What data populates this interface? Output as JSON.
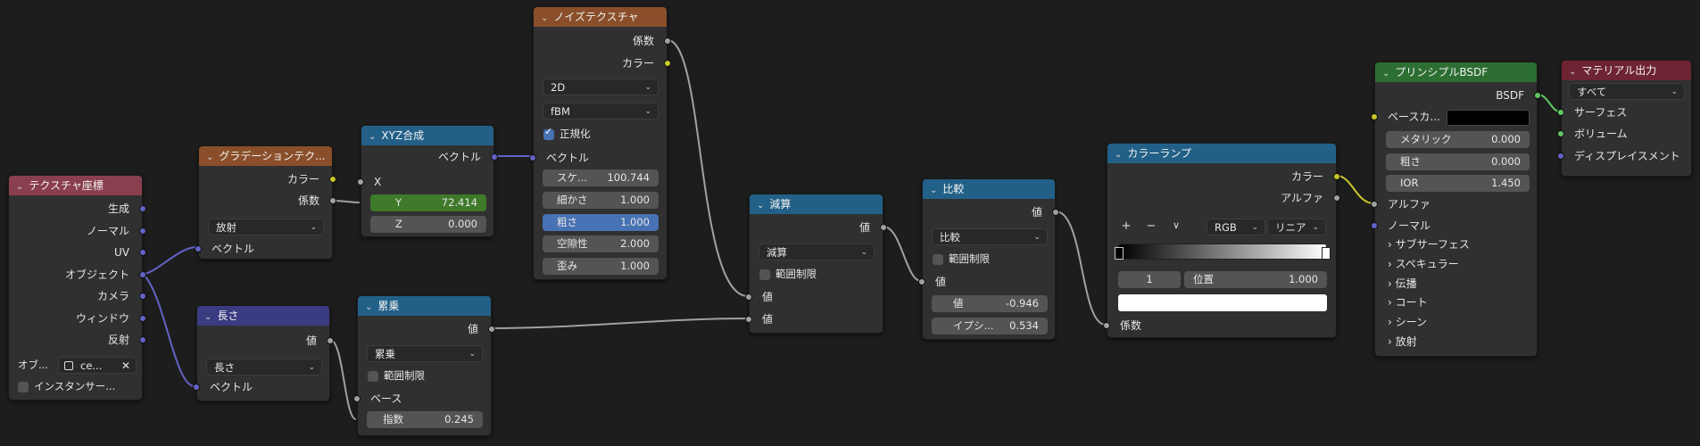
{
  "colors": {
    "tex": "#8a3f4f",
    "grad": "#8a4f2a",
    "vec": "#3b3b82",
    "conv": "#226087",
    "shader": "#2d6e33",
    "out": "#6e2433"
  },
  "nodes": {
    "texcoord": {
      "title": "テクスチャ座標",
      "outputs": [
        "生成",
        "ノーマル",
        "UV",
        "オブジェクト",
        "カメラ",
        "ウィンドウ",
        "反射"
      ],
      "object_label": "オブ...",
      "object_value": "ce...",
      "instancer_label": "インスタンサー..."
    },
    "gradient": {
      "title": "グラデーションテク...",
      "out_color": "カラー",
      "out_fac": "係数",
      "type": "放射",
      "in_vector": "ベクトル"
    },
    "length": {
      "title": "長さ",
      "out_value": "値",
      "op": "長さ",
      "in_vector": "ベクトル"
    },
    "xyz": {
      "title": "XYZ合成",
      "out_vector": "ベクトル",
      "x_label": "X",
      "y_label": "Y",
      "y_value": "72.414",
      "z_label": "Z",
      "z_value": "0.000"
    },
    "power": {
      "title": "累乗",
      "out_value": "値",
      "op": "累乗",
      "clamp": "範囲制限",
      "base": "ベース",
      "exp_label": "指数",
      "exp_value": "0.245"
    },
    "noise": {
      "title": "ノイズテクスチャ",
      "out_fac": "係数",
      "out_color": "カラー",
      "dim": "2D",
      "type": "fBM",
      "normalize": "正規化",
      "in_vector": "ベクトル",
      "scale_label": "スケ...",
      "scale_value": "100.744",
      "detail_label": "細かさ",
      "detail_value": "1.000",
      "rough_label": "粗さ",
      "rough_value": "1.000",
      "lac_label": "空隙性",
      "lac_value": "2.000",
      "dist_label": "歪み",
      "dist_value": "1.000"
    },
    "subtract": {
      "title": "減算",
      "out_value": "値",
      "op": "減算",
      "clamp": "範囲制限",
      "in1": "値",
      "in2": "値"
    },
    "compare": {
      "title": "比較",
      "out_value": "値",
      "op": "比較",
      "clamp": "範囲制限",
      "in1": "値",
      "val_label": "値",
      "val_value": "-0.946",
      "eps_label": "イプシ...",
      "eps_value": "0.534"
    },
    "ramp": {
      "title": "カラーランプ",
      "out_color": "カラー",
      "out_alpha": "アルファ",
      "plus": "+",
      "minus": "−",
      "menu": "∨",
      "mode": "RGB",
      "interp": "リニア",
      "index": "1",
      "pos_label": "位置",
      "pos_value": "1.000",
      "in_fac": "係数"
    },
    "bsdf": {
      "title": "プリンシプルBSDF",
      "out_bsdf": "BSDF",
      "base_color": "ベースカ...",
      "metal_label": "メタリック",
      "metal_value": "0.000",
      "rough_label": "粗さ",
      "rough_value": "0.000",
      "ior_label": "IOR",
      "ior_value": "1.450",
      "alpha": "アルファ",
      "normal": "ノーマル",
      "panels": [
        "サブサーフェス",
        "スペキュラー",
        "伝播",
        "コート",
        "シーン",
        "放射"
      ]
    },
    "output": {
      "title": "マテリアル出力",
      "target": "すべて",
      "surface": "サーフェス",
      "volume": "ボリューム",
      "disp": "ディスプレイスメント"
    }
  }
}
